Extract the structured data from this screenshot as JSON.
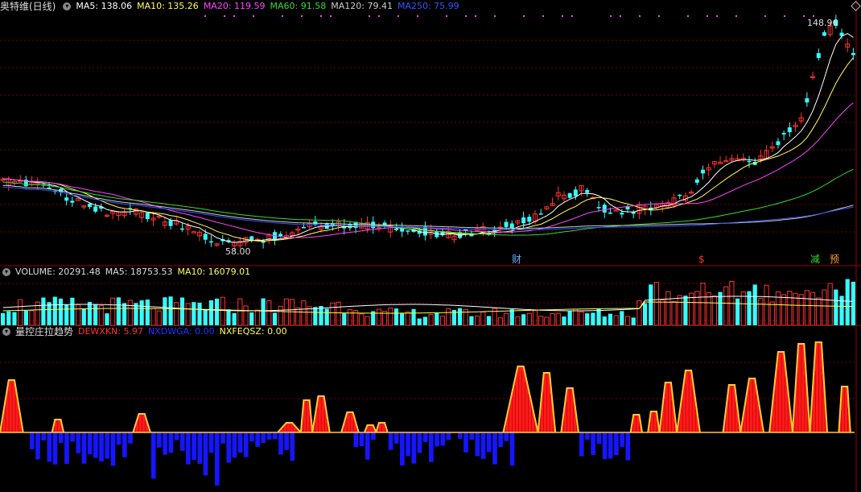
{
  "main": {
    "title": "奥特维(日线)",
    "ma": [
      {
        "label": "MA5: 138.06",
        "color": "#ffffff"
      },
      {
        "label": "MA10: 135.26",
        "color": "#ffff55"
      },
      {
        "label": "MA20: 119.59",
        "color": "#ff44ff"
      },
      {
        "label": "MA60: 91.58",
        "color": "#33dd33"
      },
      {
        "label": "MA120: 79.41",
        "color": "#cccccc"
      },
      {
        "label": "MA250: 75.99",
        "color": "#3355ff"
      }
    ],
    "high_label": "148.96",
    "low_label": "58.00",
    "events": [
      {
        "text": "财",
        "color": "#66aaff"
      },
      {
        "text": "$",
        "color": "#ff3333"
      },
      {
        "text": "减",
        "color": "#33dd33"
      },
      {
        "text": "预",
        "color": "#ff9933"
      }
    ]
  },
  "volume": {
    "title": "VOLUME: 20291.48",
    "ma5": "MA5: 18753.53",
    "ma10": "MA10: 16079.01"
  },
  "indicator": {
    "title": "量控庄拉趋势",
    "items": [
      {
        "label": "DEWXKN: 5.97",
        "color": "#ff3333"
      },
      {
        "label": "NXDWGA: 0.00",
        "color": "#2233ff"
      },
      {
        "label": "NXFEQSZ: 0.00",
        "color": "#ffff55"
      }
    ]
  },
  "colors": {
    "up": "#ff3333",
    "down": "#33ffff",
    "bg": "#000000",
    "grid": "#7a0000"
  }
}
